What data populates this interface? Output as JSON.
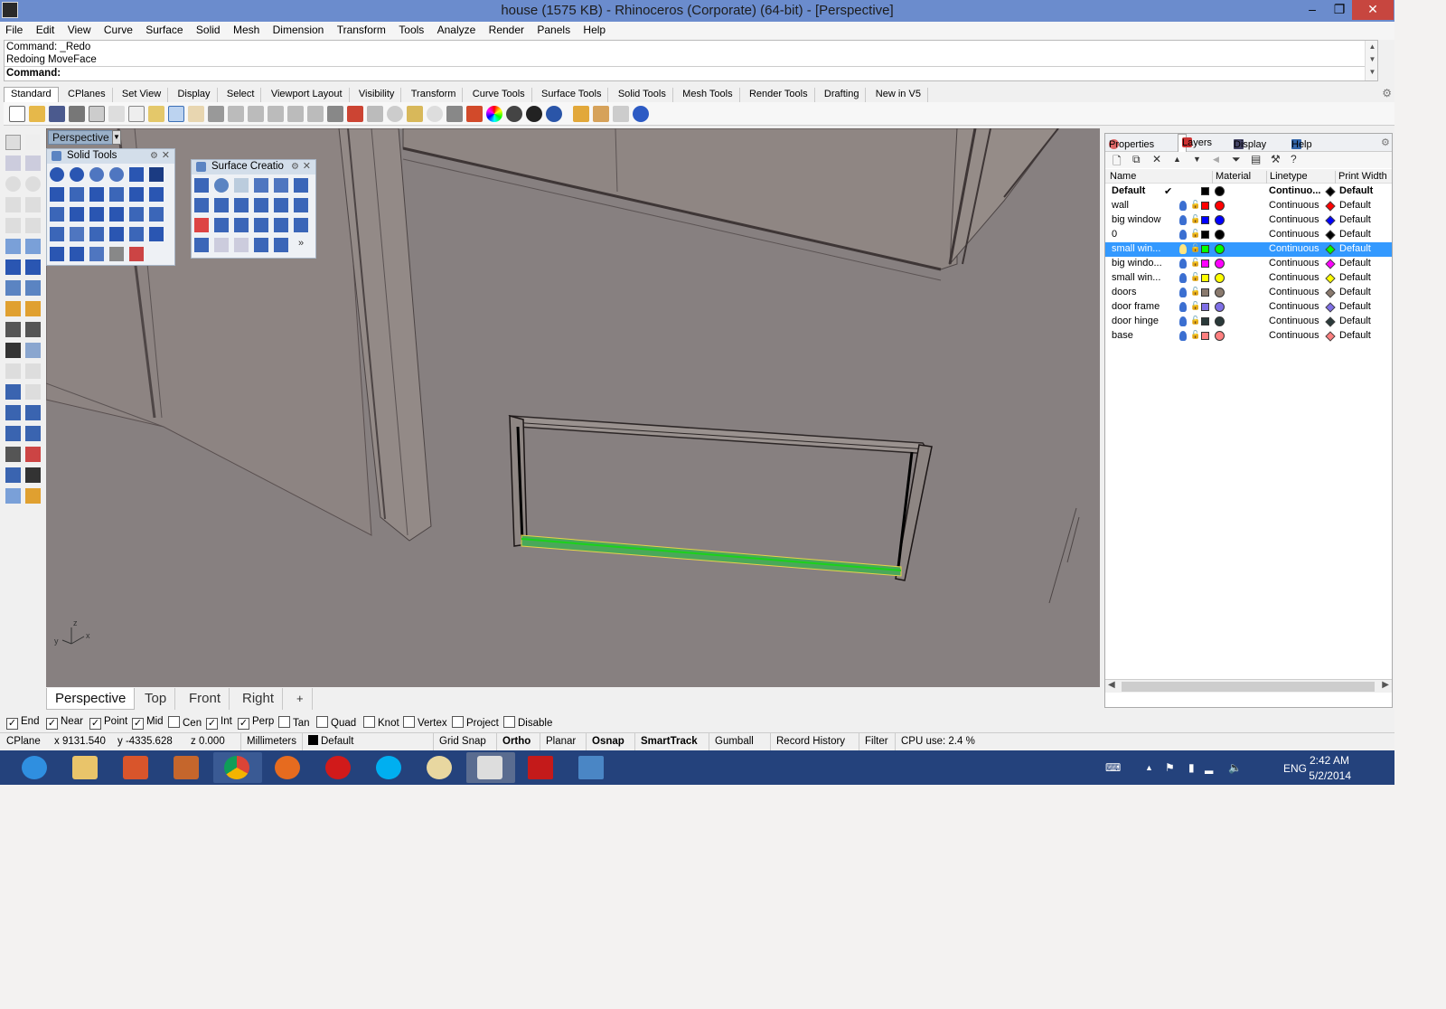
{
  "window": {
    "title": "house (1575 KB) - Rhinoceros (Corporate) (64-bit) - [Perspective]",
    "minimize": "–",
    "maximize": "❐",
    "close": "✕"
  },
  "menu": [
    "File",
    "Edit",
    "View",
    "Curve",
    "Surface",
    "Solid",
    "Mesh",
    "Dimension",
    "Transform",
    "Tools",
    "Analyze",
    "Render",
    "Panels",
    "Help"
  ],
  "command": {
    "history": [
      "Command: _Redo",
      "Redoing MoveFace"
    ],
    "prompt": "Command:"
  },
  "toolbar_tabs": [
    "Standard",
    "CPlanes",
    "Set View",
    "Display",
    "Select",
    "Viewport Layout",
    "Visibility",
    "Transform",
    "Curve Tools",
    "Surface Tools",
    "Solid Tools",
    "Mesh Tools",
    "Render Tools",
    "Drafting",
    "New in V5"
  ],
  "active_toolbar_tab": "Standard",
  "viewport": {
    "label": "Perspective",
    "axis_labels": {
      "x": "x",
      "y": "y",
      "z": "z"
    }
  },
  "floating_panels": {
    "solid_tools": "Solid Tools",
    "surface_creation": "Surface Creatio"
  },
  "viewport_tabs": [
    "Perspective",
    "Top",
    "Front",
    "Right"
  ],
  "viewport_tab_add": "+",
  "active_viewport_tab": "Perspective",
  "osnaps": [
    {
      "label": "End",
      "checked": true
    },
    {
      "label": "Near",
      "checked": true
    },
    {
      "label": "Point",
      "checked": true
    },
    {
      "label": "Mid",
      "checked": true
    },
    {
      "label": "Cen",
      "checked": false
    },
    {
      "label": "Int",
      "checked": true
    },
    {
      "label": "Perp",
      "checked": true
    },
    {
      "label": "Tan",
      "checked": false
    },
    {
      "label": "Quad",
      "checked": false
    },
    {
      "label": "Knot",
      "checked": false
    },
    {
      "label": "Vertex",
      "checked": false
    },
    {
      "label": "Project",
      "checked": false
    },
    {
      "label": "Disable",
      "checked": false
    }
  ],
  "status": {
    "cplane": "CPlane",
    "x": "x 9131.540",
    "y": "y -4335.628",
    "z": "z 0.000",
    "units": "Millimeters",
    "layer": "Default",
    "grid_snap": "Grid Snap",
    "ortho": "Ortho",
    "planar": "Planar",
    "osnap": "Osnap",
    "smarttrack": "SmartTrack",
    "gumball": "Gumball",
    "record_history": "Record History",
    "filter": "Filter",
    "cpu": "CPU use: 2.4 %"
  },
  "right_panel": {
    "tabs": [
      "Properties",
      "Layers",
      "Display",
      "Help"
    ],
    "active_tab": "Layers",
    "toolbar_icons": [
      "new-layer-icon",
      "new-sublayer-icon",
      "delete-icon",
      "move-up-icon",
      "move-down-icon",
      "move-out-icon",
      "filter-icon",
      "page-icon",
      "tools-icon",
      "help-icon"
    ],
    "columns": [
      "Name",
      "Material",
      "Linetype",
      "Print Width"
    ],
    "layers": [
      {
        "name": "Default",
        "current": "✔",
        "color": "#000000",
        "linetype": "Continuo...",
        "print_width": "Default",
        "bold": true
      },
      {
        "name": "wall",
        "current": "",
        "color": "#ff0000",
        "linetype": "Continuous",
        "print_width": "Default"
      },
      {
        "name": "big window",
        "current": "",
        "color": "#0000ff",
        "linetype": "Continuous",
        "print_width": "Default"
      },
      {
        "name": "0",
        "current": "",
        "color": "#000000",
        "linetype": "Continuous",
        "print_width": "Default"
      },
      {
        "name": "small win...",
        "current": "",
        "color": "#00ff00",
        "linetype": "Continuous",
        "print_width": "Default",
        "selected": true
      },
      {
        "name": "big windo...",
        "current": "",
        "color": "#ff00ff",
        "linetype": "Continuous",
        "print_width": "Default"
      },
      {
        "name": "small win...",
        "current": "",
        "color": "#ffff00",
        "linetype": "Continuous",
        "print_width": "Default"
      },
      {
        "name": "doors",
        "current": "",
        "color": "#8a7a6e",
        "linetype": "Continuous",
        "print_width": "Default"
      },
      {
        "name": "door frame",
        "current": "",
        "color": "#7f6fe6",
        "linetype": "Continuous",
        "print_width": "Default"
      },
      {
        "name": "door hinge",
        "current": "",
        "color": "#2a3a3a",
        "linetype": "Continuous",
        "print_width": "Default"
      },
      {
        "name": "base",
        "current": "",
        "color": "#ff7f7f",
        "linetype": "Continuous",
        "print_width": "Default"
      }
    ]
  },
  "taskbar": {
    "apps": [
      "internet-explorer",
      "file-explorer",
      "office",
      "app-4",
      "chrome",
      "firefox",
      "opera",
      "skype",
      "paint",
      "rhino",
      "autocad",
      "photos"
    ],
    "language": "ENG",
    "time": "2:42 AM",
    "date": "5/2/2014"
  }
}
